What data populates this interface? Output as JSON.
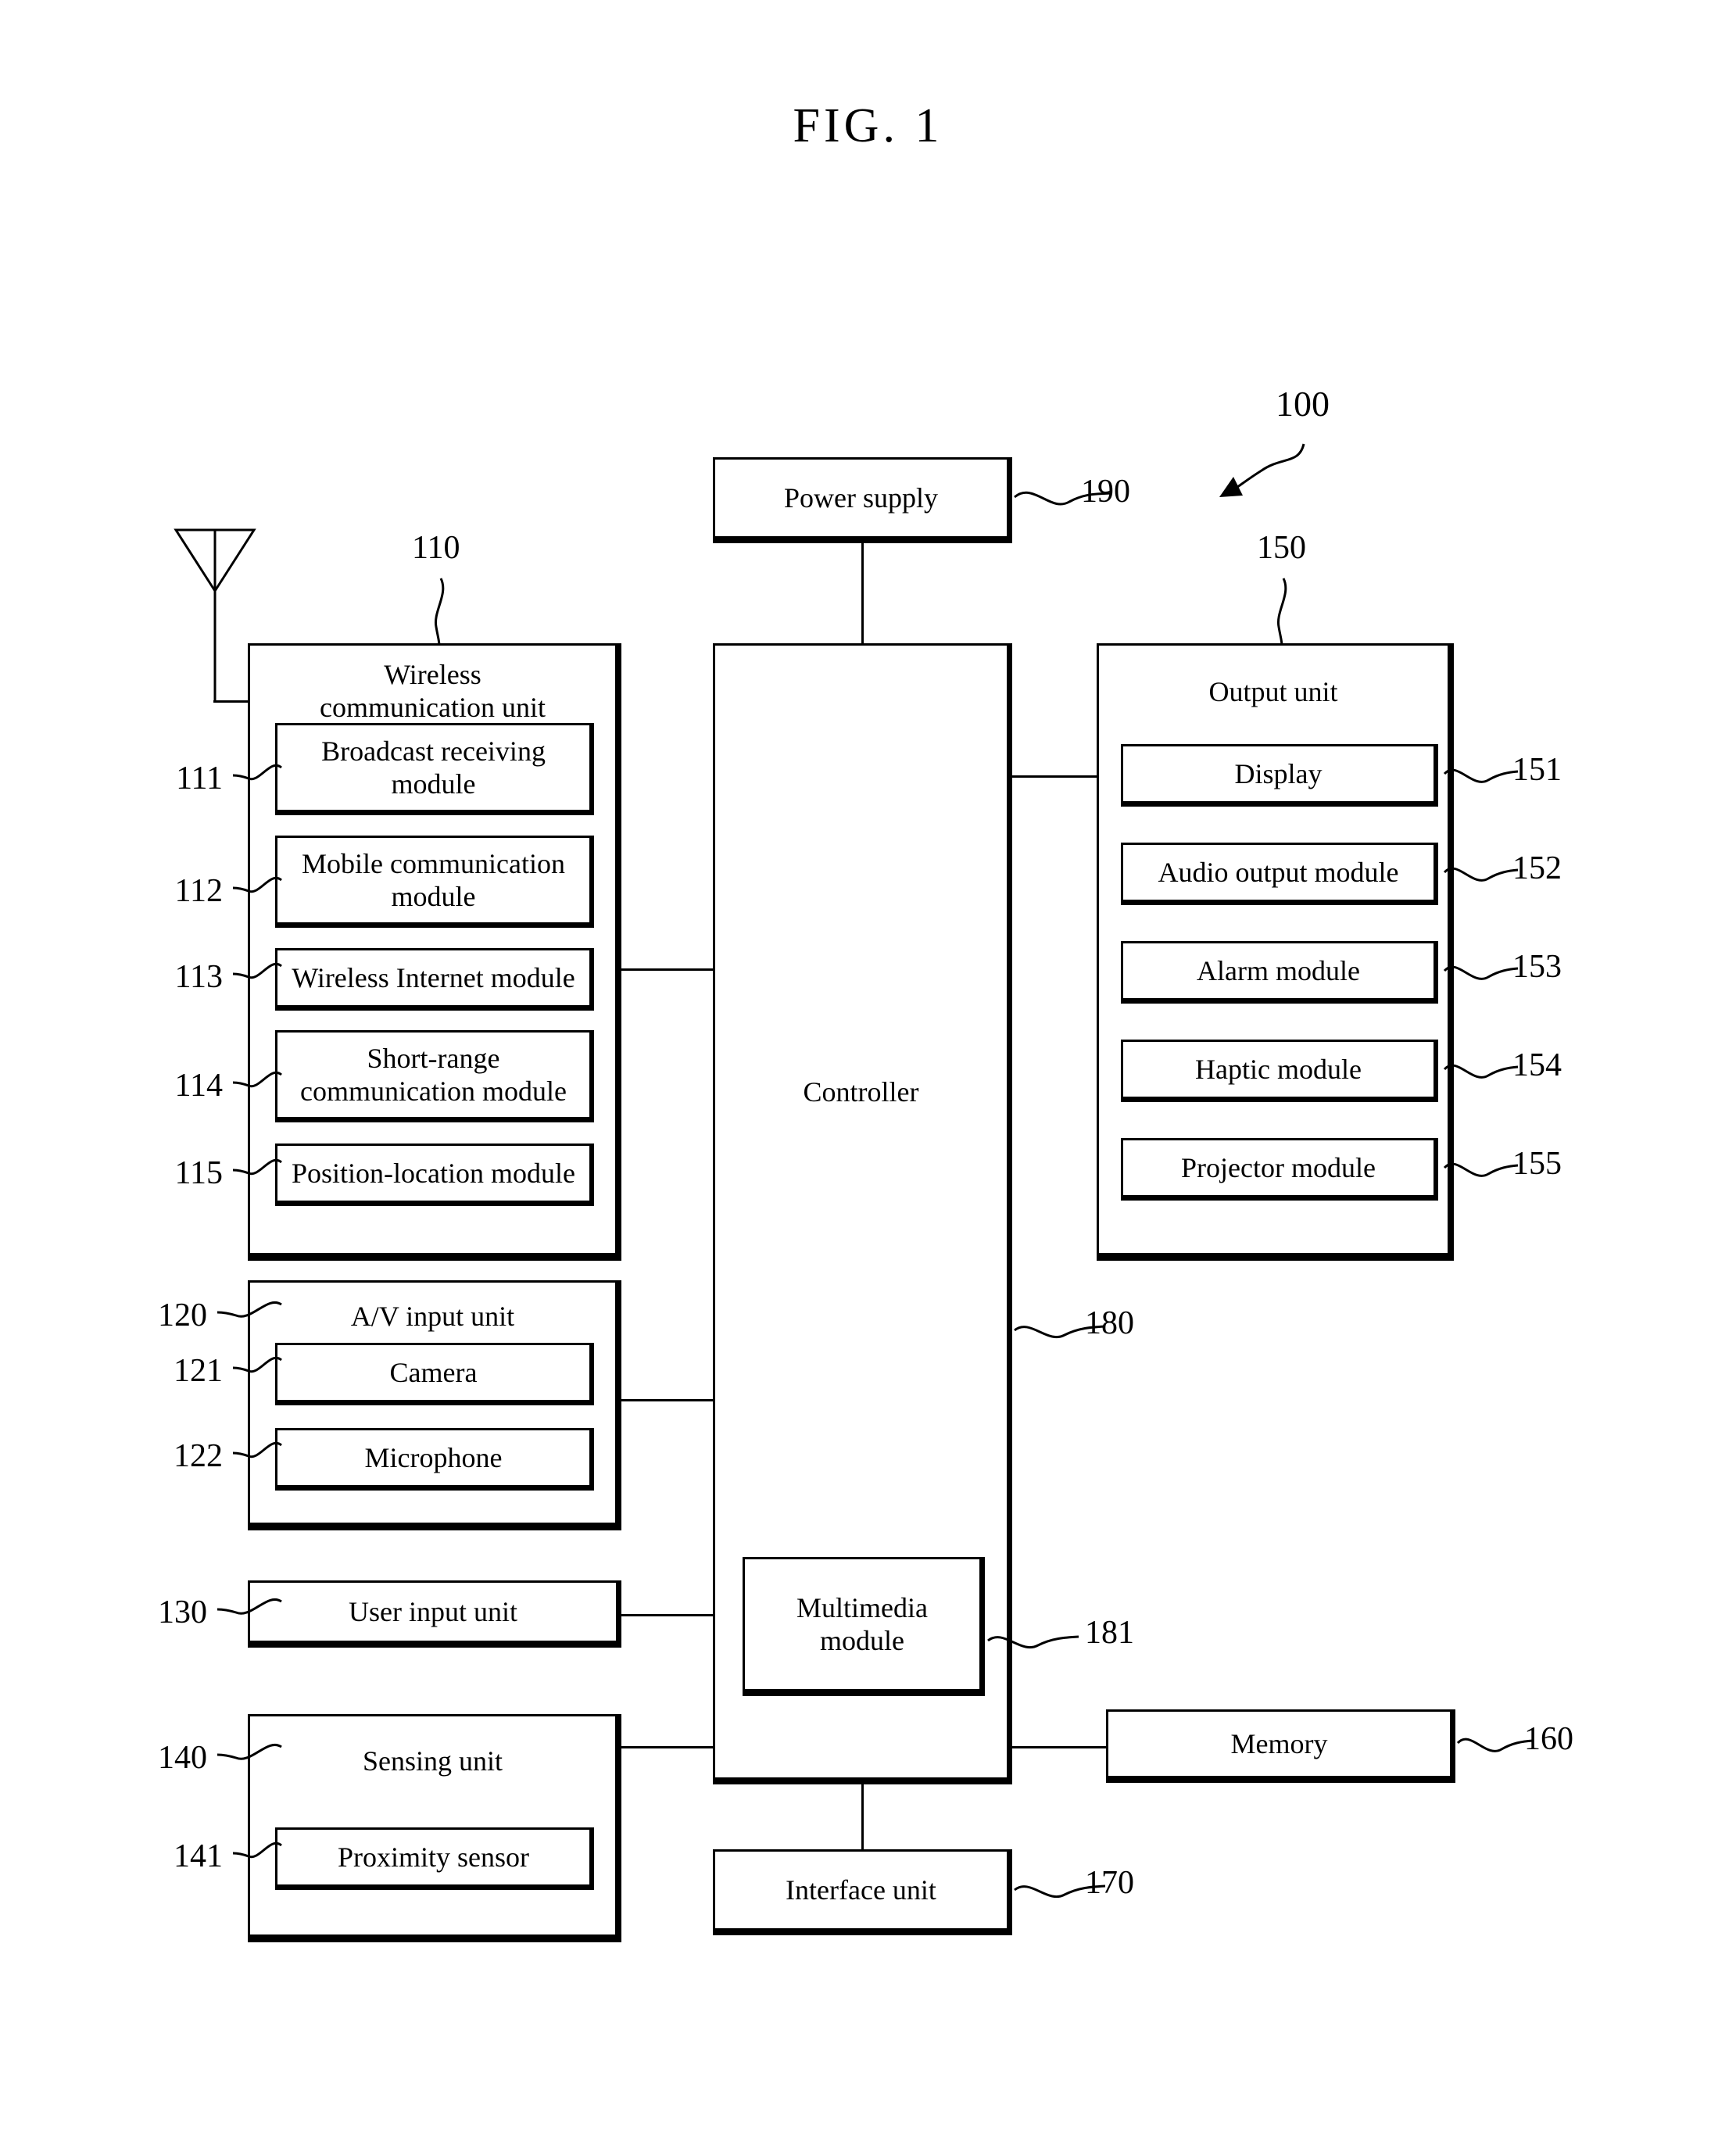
{
  "figure": {
    "title": "FIG. 1",
    "overall_ref": "100"
  },
  "blocks": {
    "power_supply": {
      "label": "Power supply",
      "ref": "190"
    },
    "controller": {
      "label": "Controller",
      "ref": "180"
    },
    "multimedia_module": {
      "label": "Multimedia\nmodule",
      "label_line1": "Multimedia",
      "label_line2": "module",
      "ref": "181"
    },
    "memory": {
      "label": "Memory",
      "ref": "160"
    },
    "interface_unit": {
      "label": "Interface unit",
      "ref": "170"
    },
    "user_input_unit": {
      "label": "User input unit",
      "ref": "130"
    }
  },
  "wireless_communication_unit": {
    "title_line1": "Wireless",
    "title_line2": "communication unit",
    "ref": "110",
    "modules": [
      {
        "ref": "111",
        "line1": "Broadcast receiving",
        "line2": "module"
      },
      {
        "ref": "112",
        "line1": "Mobile communication",
        "line2": "module"
      },
      {
        "ref": "113",
        "line1": "Wireless Internet module",
        "line2": ""
      },
      {
        "ref": "114",
        "line1": "Short-range",
        "line2": "communication module"
      },
      {
        "ref": "115",
        "line1": "Position-location module",
        "line2": ""
      }
    ]
  },
  "av_input_unit": {
    "title": "A/V input unit",
    "ref": "120",
    "modules": [
      {
        "ref": "121",
        "label": "Camera"
      },
      {
        "ref": "122",
        "label": "Microphone"
      }
    ]
  },
  "sensing_unit": {
    "title": "Sensing unit",
    "ref": "140",
    "modules": [
      {
        "ref": "141",
        "label": "Proximity sensor"
      }
    ]
  },
  "output_unit": {
    "title": "Output unit",
    "ref": "150",
    "modules": [
      {
        "ref": "151",
        "label": "Display"
      },
      {
        "ref": "152",
        "label": "Audio output module"
      },
      {
        "ref": "153",
        "label": "Alarm module"
      },
      {
        "ref": "154",
        "label": "Haptic module"
      },
      {
        "ref": "155",
        "label": "Projector module"
      }
    ]
  },
  "icons": {
    "antenna": "antenna-icon",
    "pointer": "arrow-icon"
  },
  "colors": {
    "ink": "#000000",
    "paper": "#ffffff"
  }
}
